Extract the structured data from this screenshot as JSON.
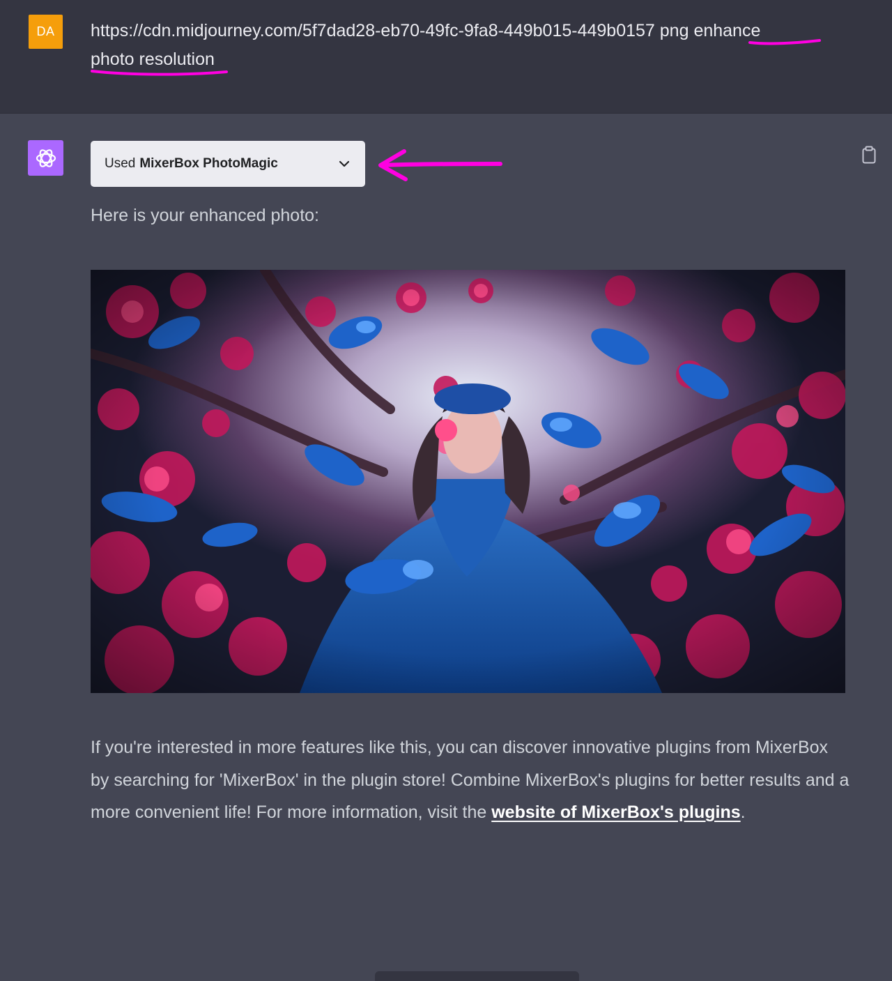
{
  "user_message": {
    "avatar_initials": "DA",
    "url_text": "https://cdn.midjourney.com/5f7dad28-eb70-49fc-9fa8-449b015-449b0157 png",
    "highlighted_text_part1": "enhance",
    "highlighted_text_part2": "photo resolution"
  },
  "assistant_message": {
    "plugin_used_prefix": "Used",
    "plugin_name": "MixerBox PhotoMagic",
    "intro": "Here is your enhanced photo:",
    "info_text_before_link": "If you're interested in more features like this, you can discover innovative plugins from MixerBox by searching for 'MixerBox' in the plugin store! Combine MixerBox's plugins for better results and a more convenient life! For more information, visit the ",
    "info_link_text": "website of MixerBox's plugins",
    "info_text_after_link": "."
  },
  "icons": {
    "plugin_expand": "chevron-down-icon",
    "copy": "clipboard-icon",
    "assistant_avatar": "openai-logo-icon"
  },
  "colors": {
    "user_bg": "#343541",
    "assistant_bg": "#444654",
    "user_avatar": "#f59e0b",
    "assistant_avatar": "#ab68ff",
    "annotation": "#ff00e1"
  }
}
